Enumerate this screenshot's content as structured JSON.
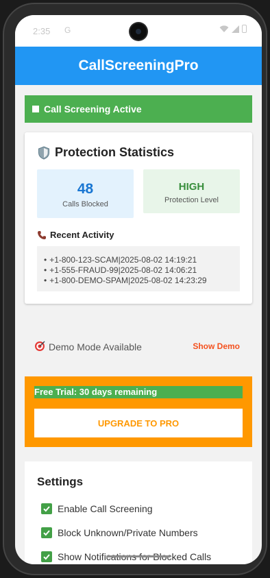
{
  "status_bar": {
    "time": "2:35",
    "notification_glyph": "G"
  },
  "app_bar": {
    "title": "CallScreeningPro"
  },
  "status_banner": {
    "text": "Call Screening Active"
  },
  "stats": {
    "title": "Protection Statistics",
    "blocked_value": "48",
    "blocked_label": "Calls Blocked",
    "level_value": "HIGH",
    "level_label": "Protection Level"
  },
  "recent": {
    "title": "Recent Activity",
    "items": [
      "+1-800-123-SCAM|2025-08-02 14:19:21",
      "+1-555-FRAUD-99|2025-08-02 14:06:21",
      "+1-800-DEMO-SPAM|2025-08-02 14:23:29"
    ]
  },
  "demo": {
    "label": "Demo Mode Available",
    "button": "Show Demo"
  },
  "trial": {
    "banner": "Free Trial: 30 days remaining",
    "upgrade_button": "UPGRADE TO PRO"
  },
  "settings": {
    "title": "Settings",
    "items": [
      {
        "label": "Enable Call Screening",
        "checked": true
      },
      {
        "label": "Block Unknown/Private Numbers",
        "checked": true
      },
      {
        "label": "Show Notifications for Blocked Calls",
        "checked": true
      }
    ]
  },
  "colors": {
    "app_bar": "#2196f3",
    "active_green": "#4caf50",
    "trial_orange": "#ff9800",
    "demo_accent": "#f4511e",
    "blocked_blue": "#1976d2",
    "level_green": "#388e3c"
  }
}
